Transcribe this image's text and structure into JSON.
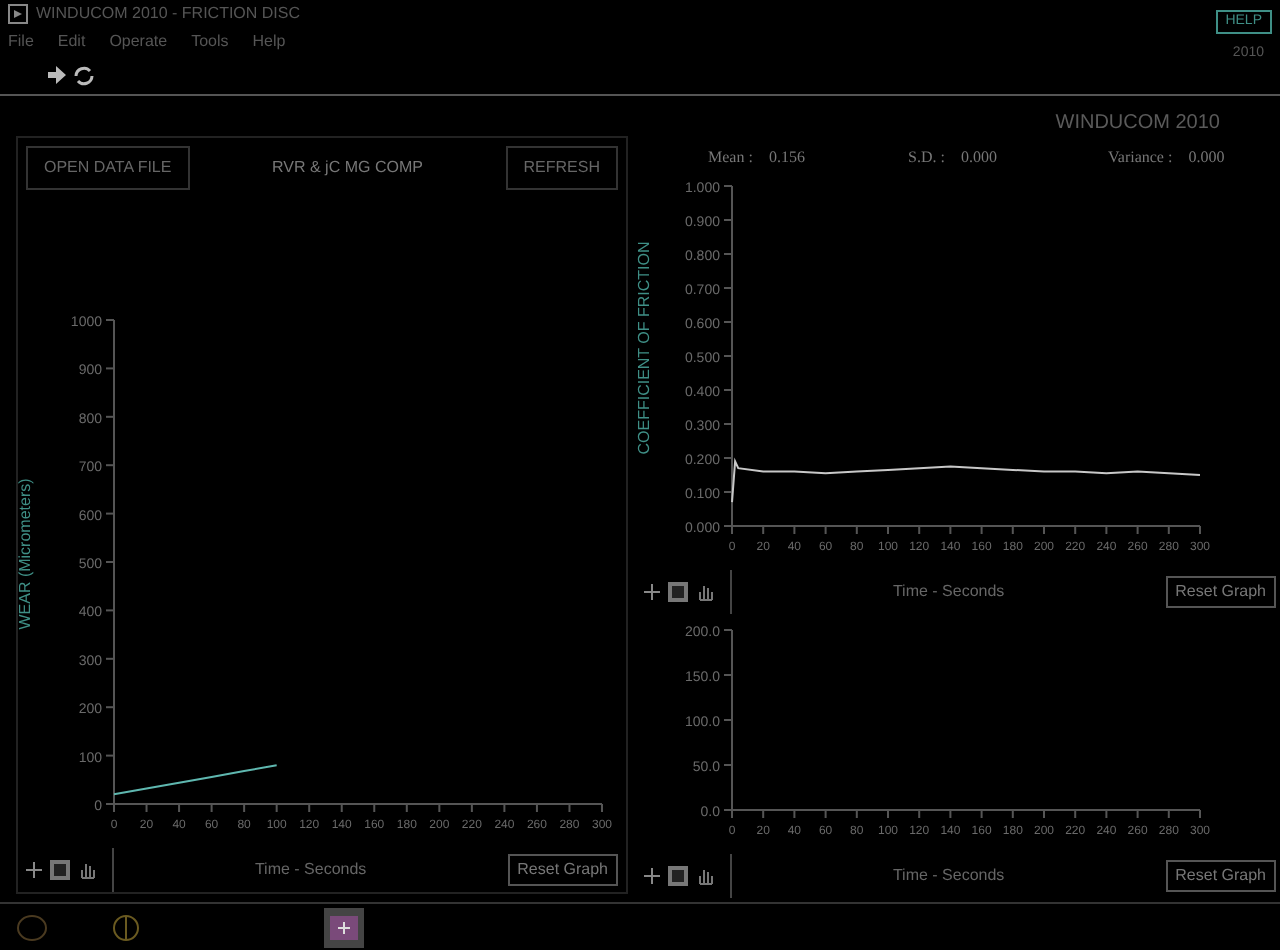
{
  "window": {
    "title": "WINDUCOM 2010 - FRICTION DISC"
  },
  "menu": [
    "File",
    "Edit",
    "Operate",
    "Tools",
    "Help"
  ],
  "header": {
    "badge": "HELP",
    "year": "2010"
  },
  "left_panel": {
    "open_button": "OPEN DATA FILE",
    "title": "RVR & jC MG COMP",
    "refresh_button": "REFRESH",
    "chart": {
      "reset_button": "Reset Graph",
      "chart_data": {
        "type": "line",
        "xlabel": "Time - Seconds",
        "ylabel": "WEAR (Micrometers)",
        "x": [
          0,
          20,
          40,
          60,
          80,
          100
        ],
        "series": [
          {
            "color": "#5fb8b0",
            "values": [
              20,
              32,
              44,
              56,
              68,
              80
            ]
          }
        ],
        "xlim": [
          0,
          300
        ],
        "ylim": [
          0,
          1000
        ],
        "xticks": [
          0,
          20,
          40,
          60,
          80,
          100,
          120,
          140,
          160,
          180,
          200,
          220,
          240,
          260,
          280,
          300
        ],
        "yticks": [
          0,
          100,
          200,
          300,
          400,
          500,
          600,
          700,
          800,
          900,
          1000
        ]
      }
    }
  },
  "right_panel": {
    "brand": "WINDUCOM 2010",
    "stats": [
      {
        "label": "Mean :",
        "value": "0.156"
      },
      {
        "label": "S.D. :",
        "value": "0.000"
      },
      {
        "label": "Variance :",
        "value": "0.000"
      }
    ],
    "charts": [
      {
        "reset_button": "Reset Graph",
        "chart_data": {
          "type": "line",
          "xlabel": "Time - Seconds",
          "ylabel": "COEFFICIENT OF FRICTION",
          "x": [
            0,
            2,
            4,
            20,
            40,
            60,
            80,
            100,
            120,
            140,
            160,
            180,
            200,
            220,
            240,
            260,
            280,
            300
          ],
          "series": [
            {
              "color": "#c8c8c8",
              "values": [
                0.07,
                0.19,
                0.17,
                0.16,
                0.16,
                0.155,
                0.16,
                0.165,
                0.17,
                0.175,
                0.17,
                0.165,
                0.16,
                0.16,
                0.155,
                0.16,
                0.155,
                0.15
              ]
            }
          ],
          "xlim": [
            0,
            300
          ],
          "ylim": [
            0,
            1
          ],
          "xticks": [
            0,
            20,
            40,
            60,
            80,
            100,
            120,
            140,
            160,
            180,
            200,
            220,
            240,
            260,
            280,
            300
          ],
          "yticks": [
            {
              "value": 0,
              "label": "0.000"
            },
            {
              "value": 0.1,
              "label": "0.100"
            },
            {
              "value": 0.2,
              "label": "0.200"
            },
            {
              "value": 0.3,
              "label": "0.300"
            },
            {
              "value": 0.4,
              "label": "0.400"
            },
            {
              "value": 0.5,
              "label": "0.500"
            },
            {
              "value": 0.6,
              "label": "0.600"
            },
            {
              "value": 0.7,
              "label": "0.700"
            },
            {
              "value": 0.8,
              "label": "0.800"
            },
            {
              "value": 0.9,
              "label": "0.900"
            },
            {
              "value": 1,
              "label": "1.000"
            }
          ]
        }
      },
      {
        "reset_button": "Reset Graph",
        "chart_data": {
          "type": "line",
          "xlabel": "Time - Seconds",
          "xlim": [
            0,
            300
          ],
          "ylim": [
            0,
            200
          ],
          "xticks": [
            0,
            20,
            40,
            60,
            80,
            100,
            120,
            140,
            160,
            180,
            200,
            220,
            240,
            260,
            280,
            300
          ],
          "yticks": [
            {
              "value": 0,
              "label": "0.0"
            },
            {
              "value": 50,
              "label": "50.0"
            },
            {
              "value": 100,
              "label": "100.0"
            },
            {
              "value": 150,
              "label": "150.0"
            },
            {
              "value": 200,
              "label": "200.0"
            }
          ]
        }
      }
    ]
  }
}
